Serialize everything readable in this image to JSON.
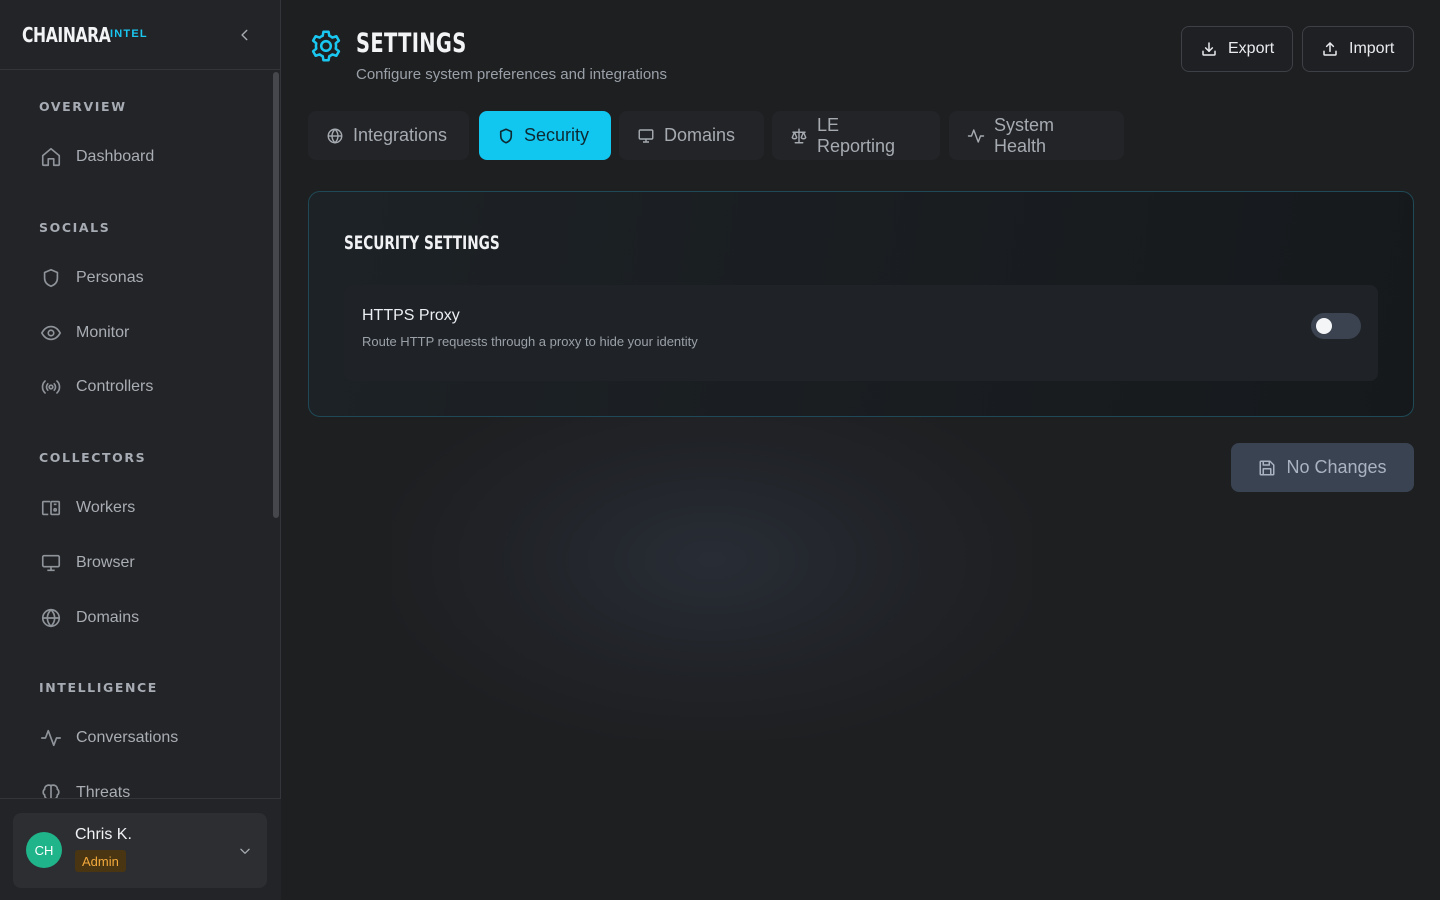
{
  "brand": {
    "name": "CHAINARA",
    "tag": "INTEL"
  },
  "colors": {
    "accent": "#11c6ef",
    "admin_badge_bg": "#4a3513",
    "admin_badge_text": "#f2a93b",
    "avatar_bg": "#1fb48a"
  },
  "sidebar": {
    "sections": [
      {
        "label": "OVERVIEW",
        "items": [
          {
            "label": "Dashboard",
            "icon": "home-icon"
          }
        ]
      },
      {
        "label": "SOCIALS",
        "items": [
          {
            "label": "Personas",
            "icon": "shield-icon"
          },
          {
            "label": "Monitor",
            "icon": "eye-icon"
          },
          {
            "label": "Controllers",
            "icon": "broadcast-icon"
          }
        ]
      },
      {
        "label": "COLLECTORS",
        "items": [
          {
            "label": "Workers",
            "icon": "devices-icon"
          },
          {
            "label": "Browser",
            "icon": "monitor-icon"
          },
          {
            "label": "Domains",
            "icon": "globe-icon"
          }
        ]
      },
      {
        "label": "INTELLIGENCE",
        "items": [
          {
            "label": "Conversations",
            "icon": "activity-icon"
          },
          {
            "label": "Threats",
            "icon": "brain-icon"
          }
        ]
      }
    ]
  },
  "user": {
    "initials": "CH",
    "name": "Chris K.",
    "role": "Admin"
  },
  "header": {
    "title": "SETTINGS",
    "subtitle": "Configure system preferences and integrations",
    "export_label": "Export",
    "import_label": "Import"
  },
  "tabs": [
    {
      "label": "Integrations",
      "icon": "globe-icon"
    },
    {
      "label": "Security",
      "icon": "shield-icon",
      "active": true
    },
    {
      "label": "Domains",
      "icon": "monitor-icon"
    },
    {
      "label": "LE Reporting",
      "icon": "scale-icon"
    },
    {
      "label": "System Health",
      "icon": "activity-icon"
    }
  ],
  "security": {
    "title": "SECURITY SETTINGS",
    "settings": [
      {
        "name": "HTTPS Proxy",
        "description": "Route HTTP requests through a proxy to hide your identity",
        "enabled": false
      }
    ]
  },
  "save_button": {
    "label": "No Changes"
  }
}
